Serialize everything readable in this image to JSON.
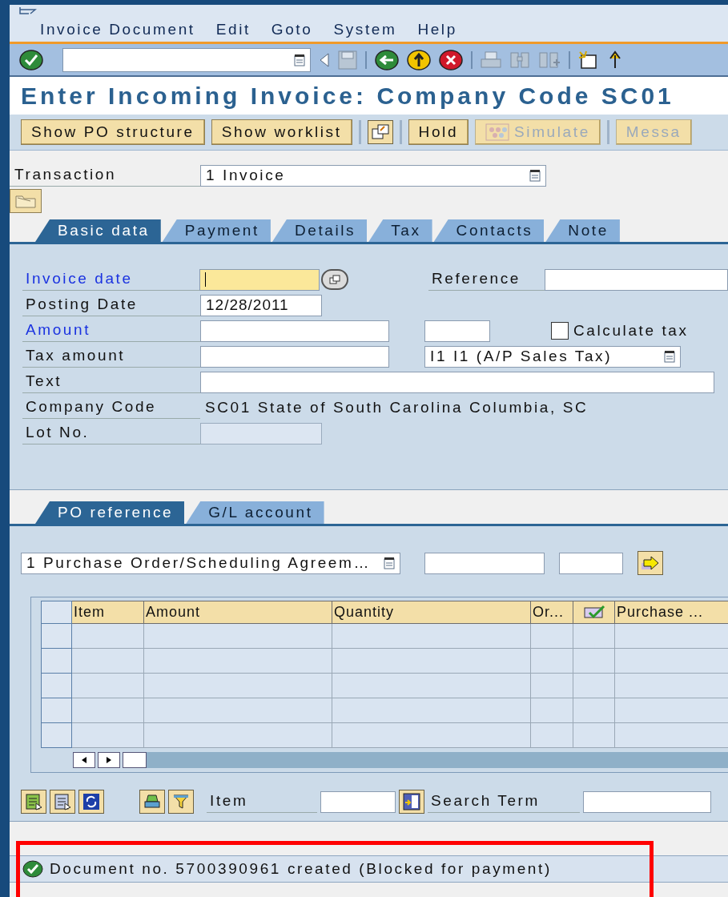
{
  "menu": [
    {
      "label": "Invoice Document"
    },
    {
      "label": "Edit"
    },
    {
      "label": "Goto"
    },
    {
      "label": "System"
    },
    {
      "label": "Help"
    }
  ],
  "title": "Enter Incoming Invoice: Company Code SC01",
  "app_buttons": [
    {
      "kind": "text",
      "label": "Show PO structure",
      "disabled": false
    },
    {
      "kind": "text",
      "label": "Show worklist",
      "disabled": false
    },
    {
      "kind": "icon",
      "disabled": false
    },
    {
      "kind": "text",
      "label": "Hold",
      "disabled": false
    },
    {
      "kind": "icontext",
      "label": "Simulate",
      "disabled": true
    },
    {
      "kind": "text",
      "label": "Messa",
      "disabled": true
    }
  ],
  "transaction": {
    "label": "Transaction",
    "value": "1 Invoice"
  },
  "tabs": [
    {
      "label": "Basic data",
      "selected": true
    },
    {
      "label": "Payment",
      "selected": false
    },
    {
      "label": "Details",
      "selected": false
    },
    {
      "label": "Tax",
      "selected": false
    },
    {
      "label": "Contacts",
      "selected": false
    },
    {
      "label": "Note",
      "selected": false
    }
  ],
  "basic_data": {
    "invoice_date": {
      "label": "Invoice date",
      "required": true,
      "focused": true
    },
    "reference": {
      "label": "Reference"
    },
    "posting_date": {
      "label": "Posting Date",
      "required": false,
      "value": "12/28/2011"
    },
    "amount": {
      "label": "Amount",
      "required": true
    },
    "calculate_tax": {
      "label": "Calculate tax",
      "checked": false
    },
    "tax_amount": {
      "label": "Tax amount",
      "required": false
    },
    "tax_code": {
      "value": "I1 I1 (A/P Sales Tax)"
    },
    "text": {
      "label": "Text",
      "required": false
    },
    "company_code": {
      "label": "Company Code",
      "value": "SC01 State of South Carolina Columbia, SC"
    },
    "lot_no": {
      "label": "Lot No.",
      "disabled": true
    }
  },
  "po_tabs": [
    {
      "label": "PO reference",
      "selected": true
    },
    {
      "label": "G/L account",
      "selected": false
    }
  ],
  "reference_type": {
    "value": "1 Purchase Order/Scheduling Agreem…"
  },
  "table": {
    "columns": [
      {
        "kind": "text",
        "label": "Item"
      },
      {
        "kind": "text",
        "label": "Amount"
      },
      {
        "kind": "text",
        "label": "Quantity"
      },
      {
        "kind": "text",
        "label": "Or..."
      },
      {
        "kind": "icon"
      },
      {
        "kind": "text",
        "label": "Purchase ..."
      }
    ]
  },
  "item_search": {
    "item_label": "Item",
    "term_label": "Search Term"
  },
  "status": {
    "kind": "success",
    "text": "Document no. 5700390961 created (Blocked for payment)",
    "highlighted": true
  }
}
